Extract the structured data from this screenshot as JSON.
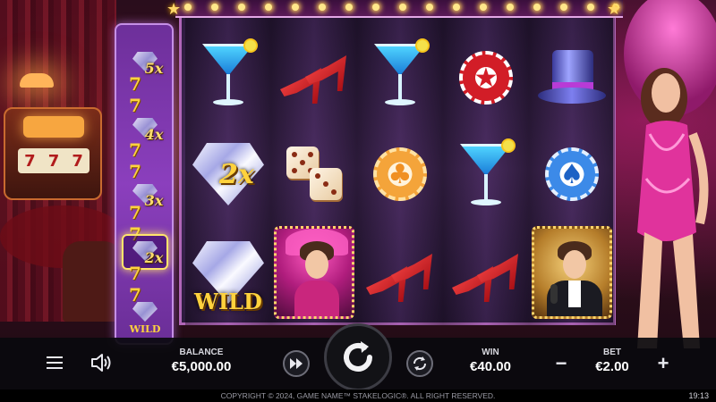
{
  "game": {
    "copyright": "COPYRIGHT © 2024, GAME NAME™ STAKELOGIC®. ALL RIGHT RESERVED.",
    "clock": "19:13"
  },
  "multiplier_column": {
    "items": [
      {
        "type": "multiplier",
        "label": "5x"
      },
      {
        "type": "sevens",
        "label": "7 7"
      },
      {
        "type": "multiplier",
        "label": "4x"
      },
      {
        "type": "sevens",
        "label": "7 7"
      },
      {
        "type": "multiplier",
        "label": "3x"
      },
      {
        "type": "sevens",
        "label": "7 7"
      },
      {
        "type": "multiplier",
        "label": "2x",
        "active": true
      },
      {
        "type": "sevens",
        "label": "7 7"
      },
      {
        "type": "wild",
        "label": "WILD"
      }
    ]
  },
  "reels": [
    [
      "martini",
      "diamond-2x",
      "diamond-wild"
    ],
    [
      "red-heels",
      "dice",
      "showgirl"
    ],
    [
      "martini",
      "gold-club-chip",
      "red-heels"
    ],
    [
      "red-star-chips",
      "martini",
      "red-heels"
    ],
    [
      "top-hat",
      "blue-spade-chip",
      "singer"
    ]
  ],
  "symbols": {
    "diamond_multiplier": "2x",
    "wild_label": "WILD",
    "red_chip_glyph": "★",
    "gold_chip_glyph": "♣",
    "blue_chip_glyph": "♠"
  },
  "controls": {
    "balance_label": "BALANCE",
    "balance_value": "€5,000.00",
    "win_label": "WIN",
    "win_value": "€40.00",
    "bet_label": "BET",
    "bet_value": "€2.00",
    "minus": "−",
    "plus": "+"
  }
}
